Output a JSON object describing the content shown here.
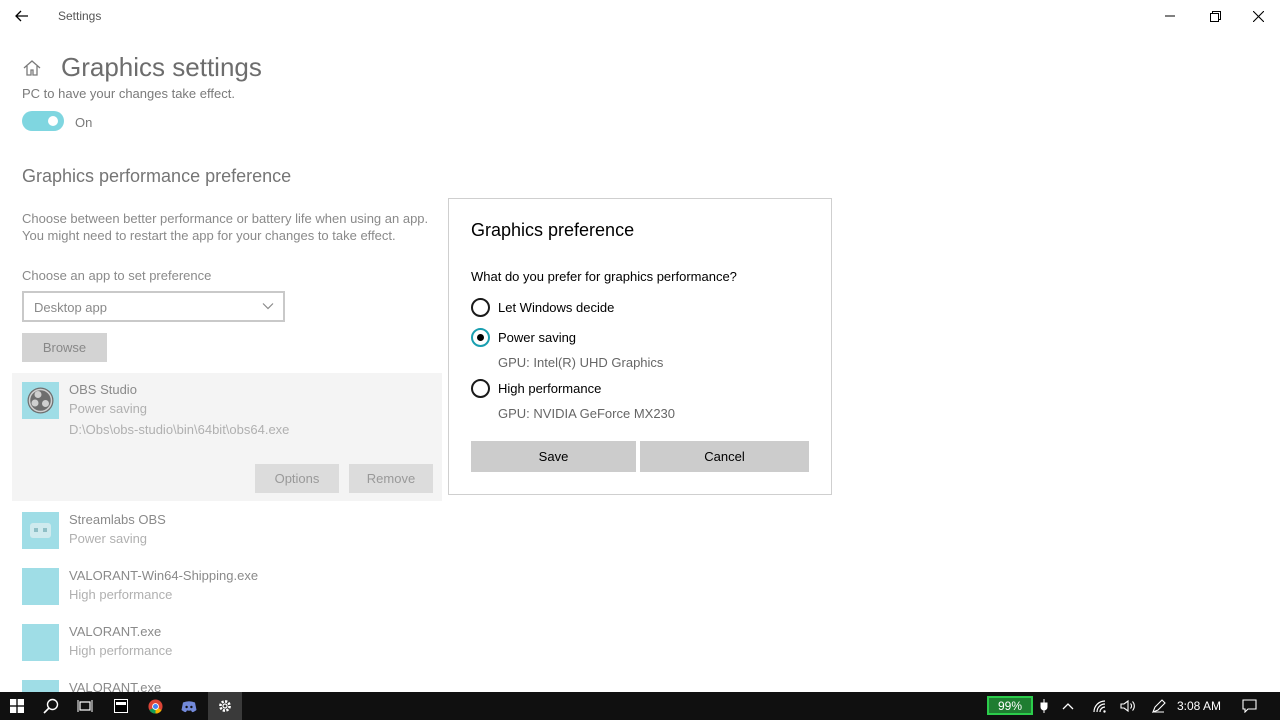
{
  "window": {
    "title": "Settings"
  },
  "page": {
    "title": "Graphics settings",
    "cut_text": "PC to have your changes take effect.",
    "toggle_label": "On",
    "section_title": "Graphics performance preference",
    "description_line1": "Choose between better performance or battery life when using an app.",
    "description_line2": "You might need to restart the app for your changes to take effect.",
    "choose_label": "Choose an app to set preference",
    "dropdown_value": "Desktop app",
    "browse_label": "Browse",
    "apps": [
      {
        "name": "OBS Studio",
        "preference": "Power saving",
        "path": "D:\\Obs\\obs-studio\\bin\\64bit\\obs64.exe"
      },
      {
        "name": "Streamlabs OBS",
        "preference": "Power saving"
      },
      {
        "name": "VALORANT-Win64-Shipping.exe",
        "preference": "High performance"
      },
      {
        "name": "VALORANT.exe",
        "preference": "High performance"
      },
      {
        "name": "VALORANT.exe"
      }
    ],
    "options_label": "Options",
    "remove_label": "Remove"
  },
  "dialog": {
    "title": "Graphics preference",
    "question": "What do you prefer for graphics performance?",
    "options": [
      {
        "label": "Let Windows decide",
        "checked": false
      },
      {
        "label": "Power saving",
        "checked": true,
        "gpu": "GPU: Intel(R) UHD Graphics"
      },
      {
        "label": "High performance",
        "checked": false,
        "gpu": "GPU: NVIDIA GeForce MX230"
      }
    ],
    "save_label": "Save",
    "cancel_label": "Cancel"
  },
  "taskbar": {
    "battery": "99%",
    "time": "3:08 AM"
  },
  "colors": {
    "accent": "#1a9fb0",
    "toggle_on": "#7fd6e0",
    "battery_green": "#1f7d31"
  }
}
